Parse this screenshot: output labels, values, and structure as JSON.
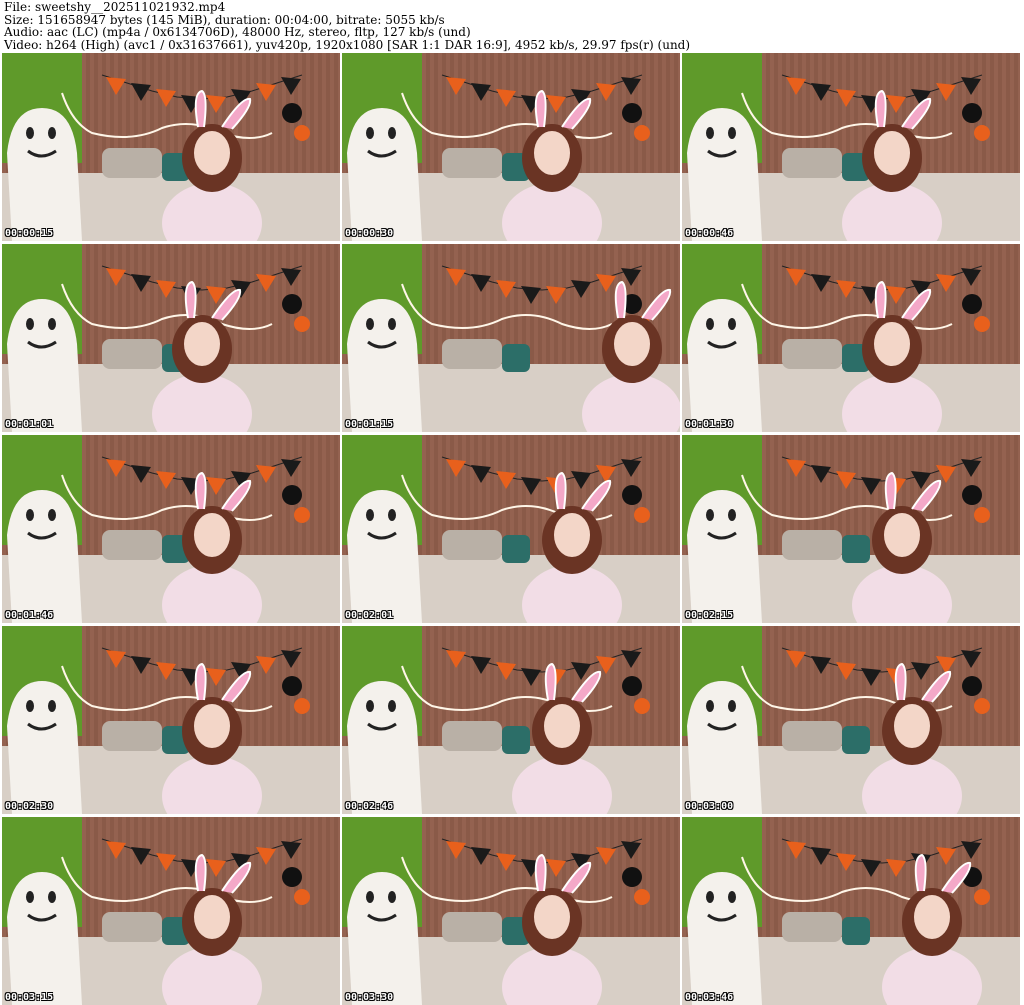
{
  "header": {
    "line1": "File: sweetshy__202511021932.mp4",
    "line2": "Size: 151658947 bytes (145 MiB), duration: 00:04:00, bitrate: 5055 kb/s",
    "line3": "Audio: aac (LC) (mp4a / 0x6134706D), 48000 Hz, stereo, fltp, 127 kb/s (und)",
    "line4": "Video: h264 (High) (avc1 / 0x31637661), yuv420p, 1920x1080 [SAR 1:1 DAR 16:9], 4952 kb/s, 29.97 fps(r) (und)"
  },
  "colors": {
    "wall": "#8a5a48",
    "green_wall": "#5f9a2a",
    "ghost": "#f4f1ec",
    "bunting_orange": "#e8601c",
    "bunting_black": "#1a1a1a",
    "top_pink": "#f2dde6",
    "hair": "#6a3424",
    "ears": "#f4a8c8",
    "bed": "#d8cfc6",
    "pillow_teal": "#2c6e68"
  },
  "thumbnails": [
    {
      "timestamp": "00:00:15"
    },
    {
      "timestamp": "00:00:30"
    },
    {
      "timestamp": "00:00:46"
    },
    {
      "timestamp": "00:01:01"
    },
    {
      "timestamp": "00:01:15"
    },
    {
      "timestamp": "00:01:30"
    },
    {
      "timestamp": "00:01:46"
    },
    {
      "timestamp": "00:02:01"
    },
    {
      "timestamp": "00:02:15"
    },
    {
      "timestamp": "00:02:30"
    },
    {
      "timestamp": "00:02:46"
    },
    {
      "timestamp": "00:03:00"
    },
    {
      "timestamp": "00:03:15"
    },
    {
      "timestamp": "00:03:30"
    },
    {
      "timestamp": "00:03:46"
    }
  ]
}
